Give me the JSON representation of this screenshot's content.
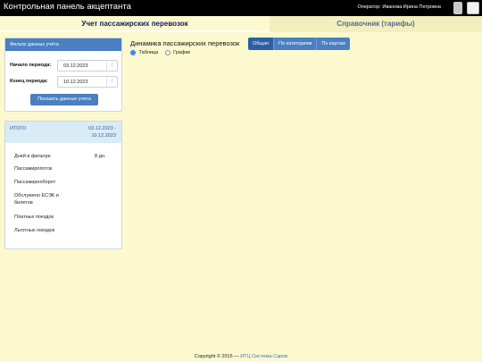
{
  "header": {
    "title": "Контрольная панель акцептанта",
    "operator": "Оператор: Иванова Ирина Петровна"
  },
  "tabs": [
    {
      "label": "Учет пассажирских перевозок",
      "active": true
    },
    {
      "label": "Справочник (тарифы)",
      "active": false
    }
  ],
  "filter": {
    "title": "Фильтр данных учёта",
    "start_label": "Начало периода:",
    "start_value": "03.12.2023",
    "end_label": "Конец периода:",
    "end_value": "10.12.2023",
    "calendar_icon": "calendar-icon",
    "show_button": "Показать данные учета"
  },
  "totals": {
    "title": "ИТОГО",
    "range": "03.12.2023 - 10.12.2023",
    "metrics": [
      {
        "label": "Дней в фильтре",
        "value": "8 дн."
      },
      {
        "label": "Пассажиропоток",
        "value": ""
      },
      {
        "label": "Пассажирооборот",
        "value": ""
      },
      {
        "label": "Обслужено ЕСЭК и билетов",
        "value": ""
      },
      {
        "label": "Платных поездок",
        "value": ""
      },
      {
        "label": "Льготных поездок",
        "value": ""
      }
    ]
  },
  "main": {
    "title": "Динамика пассажирских перевозок",
    "view_options": [
      {
        "label": "Таблица",
        "selected": true
      },
      {
        "label": "График",
        "selected": false
      }
    ],
    "group_buttons": [
      {
        "label": "Общая",
        "active": true
      },
      {
        "label": "По категориям",
        "active": false
      },
      {
        "label": "По картам",
        "active": false
      }
    ]
  },
  "footer": {
    "copyright": "Copyright © 2015 —",
    "company": "ИТЦ Система-Саров"
  },
  "colors": {
    "background": "#fdf9cf",
    "accent": "#4a7fc1",
    "topbar": "#000000"
  }
}
